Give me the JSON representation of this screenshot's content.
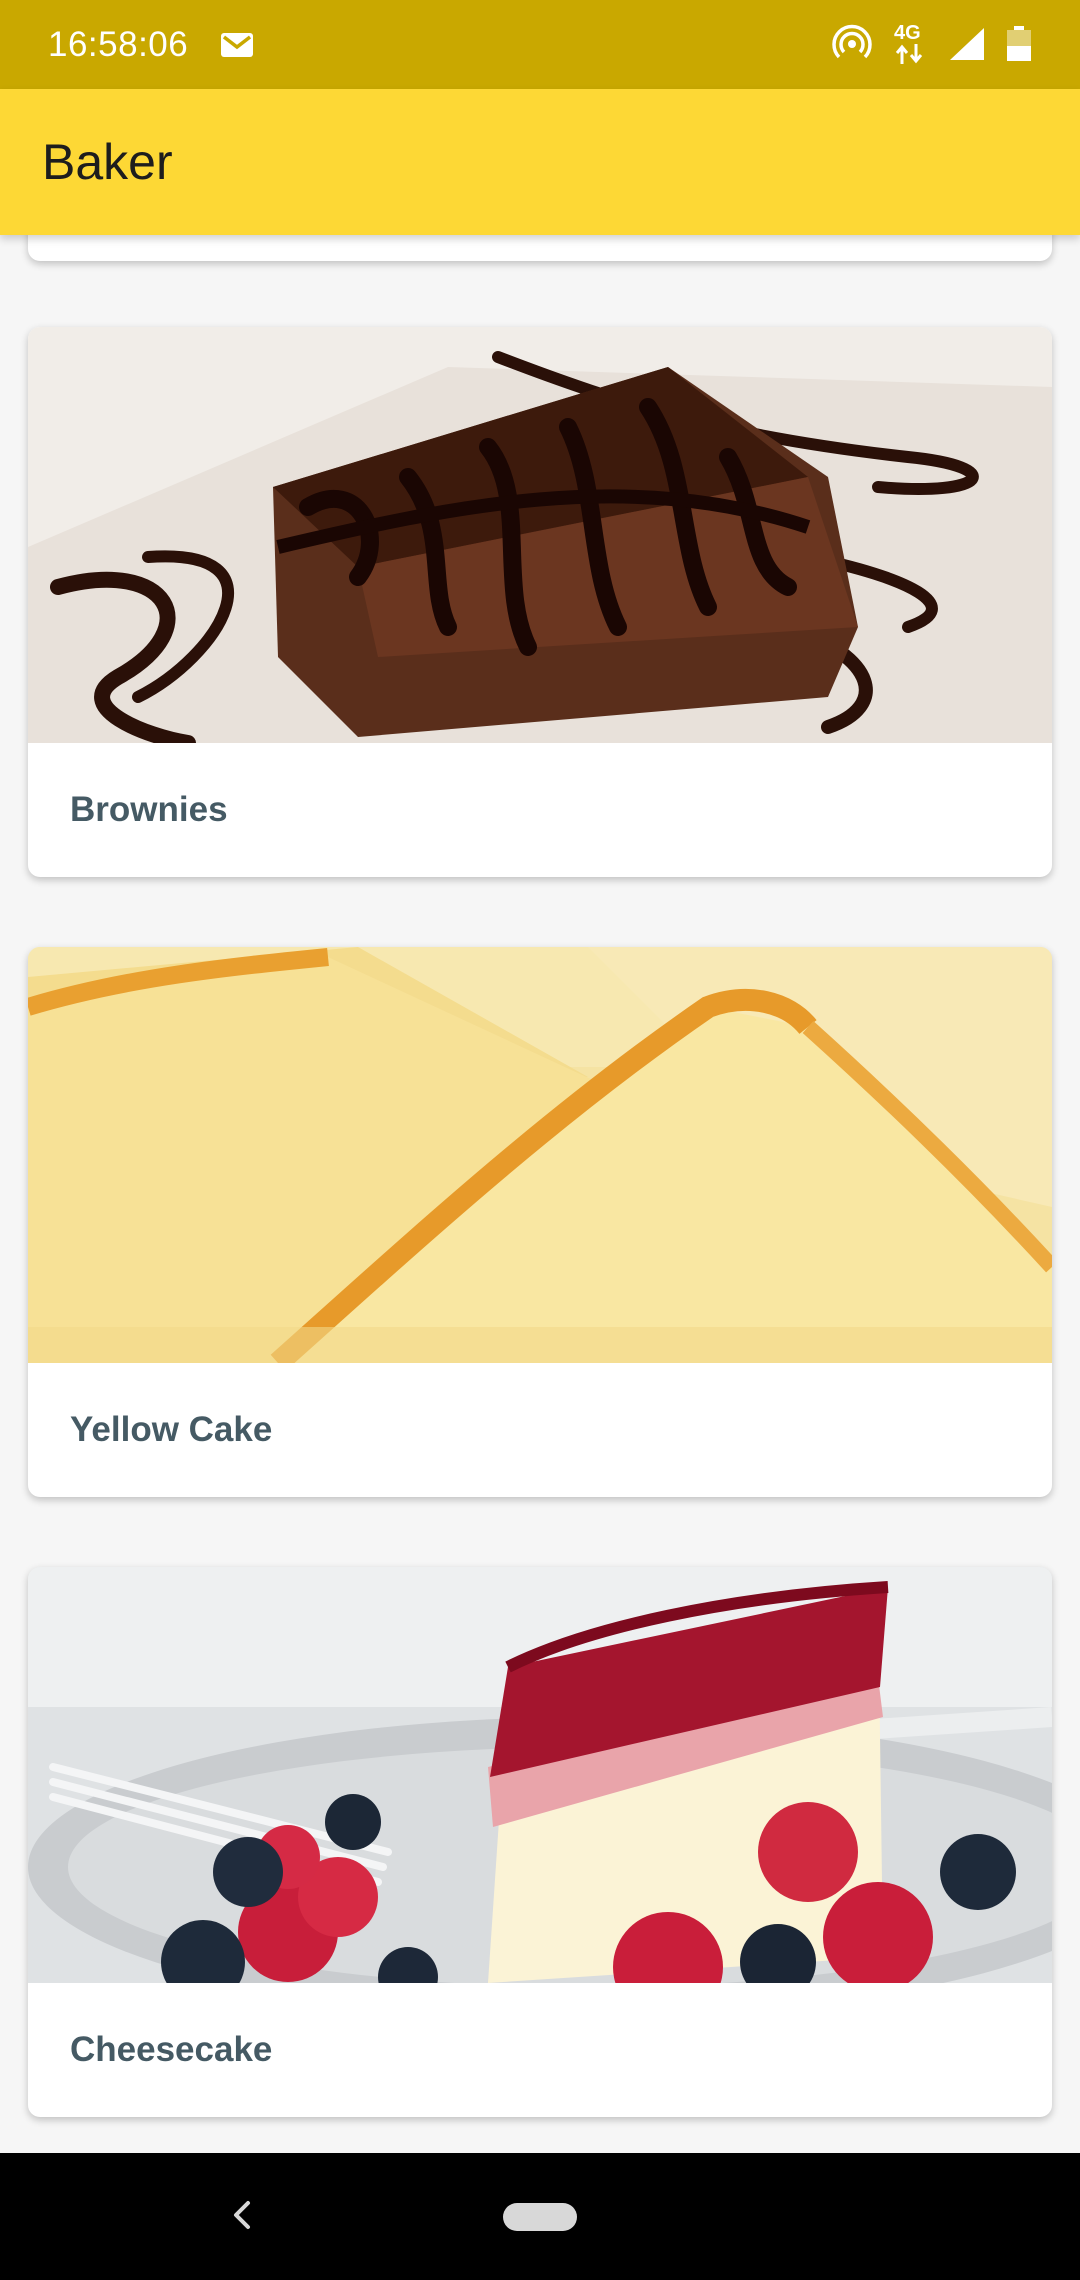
{
  "status_bar": {
    "time": "16:58:06",
    "network_label": "4G",
    "icons": [
      "gmail-icon",
      "hotspot-icon",
      "network-4g-icon",
      "signal-icon",
      "battery-icon"
    ]
  },
  "app_bar": {
    "title": "Baker"
  },
  "recipes": [
    {
      "name": "Brownies",
      "image": "brownie-photo"
    },
    {
      "name": "Yellow Cake",
      "image": "yellow-cake-photo"
    },
    {
      "name": "Cheesecake",
      "image": "cheesecake-photo"
    }
  ],
  "colors": {
    "status_bar": "#c9a800",
    "app_bar": "#fdd835",
    "label_text": "#455a64",
    "background": "#f6f6f6"
  },
  "nav_bar": {
    "icons": [
      "back-icon",
      "home-pill-icon"
    ]
  }
}
